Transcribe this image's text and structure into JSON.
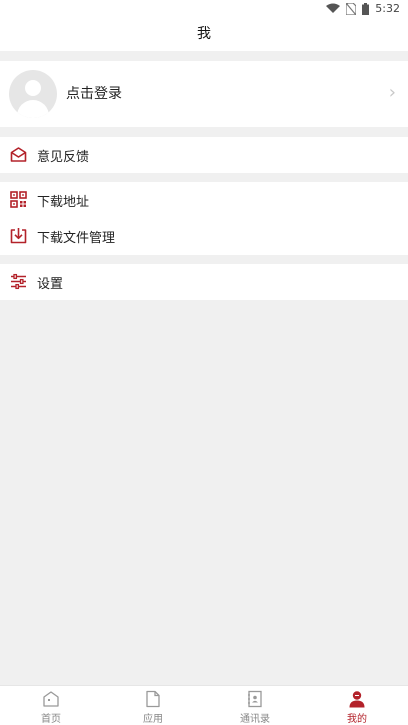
{
  "status_bar": {
    "time": "5:32",
    "icons": [
      "wifi-icon",
      "no-sim-icon",
      "battery-icon"
    ]
  },
  "header": {
    "title": "我"
  },
  "profile": {
    "login_label": "点击登录",
    "chevron": "›"
  },
  "menu": {
    "feedback": {
      "label": "意见反馈",
      "icon": "envelope-icon"
    },
    "download_address": {
      "label": "下载地址",
      "icon": "qrcode-icon"
    },
    "download_manager": {
      "label": "下载文件管理",
      "icon": "download-tray-icon"
    },
    "settings": {
      "label": "设置",
      "icon": "sliders-icon"
    }
  },
  "tabs": [
    {
      "label": "首页",
      "icon": "home-icon",
      "active": false
    },
    {
      "label": "应用",
      "icon": "document-icon",
      "active": false
    },
    {
      "label": "通讯录",
      "icon": "contacts-book-icon",
      "active": false
    },
    {
      "label": "我的",
      "icon": "user-icon",
      "active": true
    }
  ],
  "colors": {
    "accent": "#b3222a",
    "background": "#f0f0f0",
    "inactive_tab": "#888888"
  }
}
